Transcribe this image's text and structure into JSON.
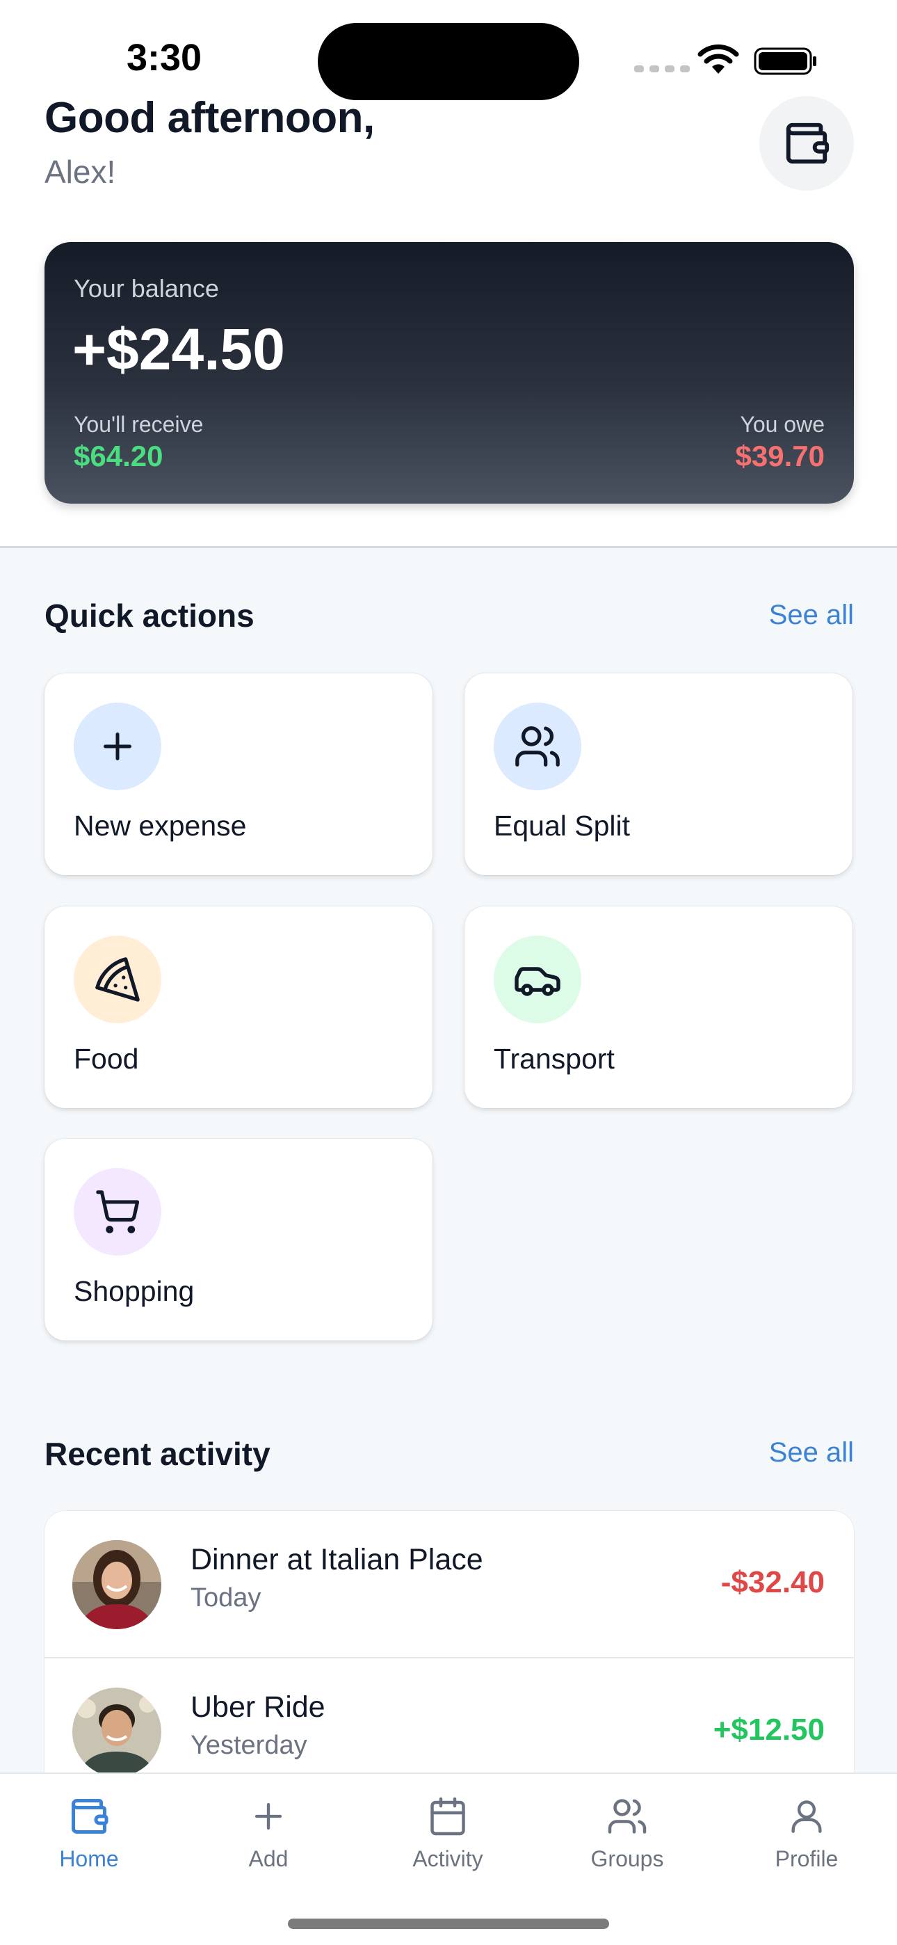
{
  "status_bar": {
    "time": "3:30"
  },
  "header": {
    "greeting": "Good afternoon,",
    "name": "Alex!",
    "wallet_icon": "wallet-icon"
  },
  "balance": {
    "label": "Your balance",
    "amount": "+$24.50",
    "receive_label": "You'll receive",
    "receive_amount": "$64.20",
    "owe_label": "You owe",
    "owe_amount": "$39.70",
    "colors": {
      "receive": "#4ade80",
      "owe": "#f87171"
    }
  },
  "quick_actions": {
    "title": "Quick actions",
    "see_all": "See all",
    "items": [
      {
        "label": "New expense",
        "icon": "plus-icon",
        "color": "#dbeafe"
      },
      {
        "label": "Equal Split",
        "icon": "users-icon",
        "color": "#dbeafe"
      },
      {
        "label": "Food",
        "icon": "pizza-icon",
        "color": "#ffedd5"
      },
      {
        "label": "Transport",
        "icon": "car-icon",
        "color": "#dcfce7"
      },
      {
        "label": "Shopping",
        "icon": "cart-icon",
        "color": "#f3e8ff"
      }
    ]
  },
  "recent_activity": {
    "title": "Recent activity",
    "see_all": "See all",
    "items": [
      {
        "title": "Dinner at Italian Place",
        "date": "Today",
        "amount": "-$32.40",
        "color": "#e04848"
      },
      {
        "title": "Uber Ride",
        "date": "Yesterday",
        "amount": "+$12.50",
        "color": "#22c55e"
      }
    ]
  },
  "tab_bar": {
    "accent": "#3b82d6",
    "tabs": [
      {
        "label": "Home",
        "icon": "wallet-icon",
        "active": true
      },
      {
        "label": "Add",
        "icon": "plus-icon"
      },
      {
        "label": "Activity",
        "icon": "calendar-icon"
      },
      {
        "label": "Groups",
        "icon": "users-icon"
      },
      {
        "label": "Profile",
        "icon": "user-icon"
      }
    ]
  }
}
